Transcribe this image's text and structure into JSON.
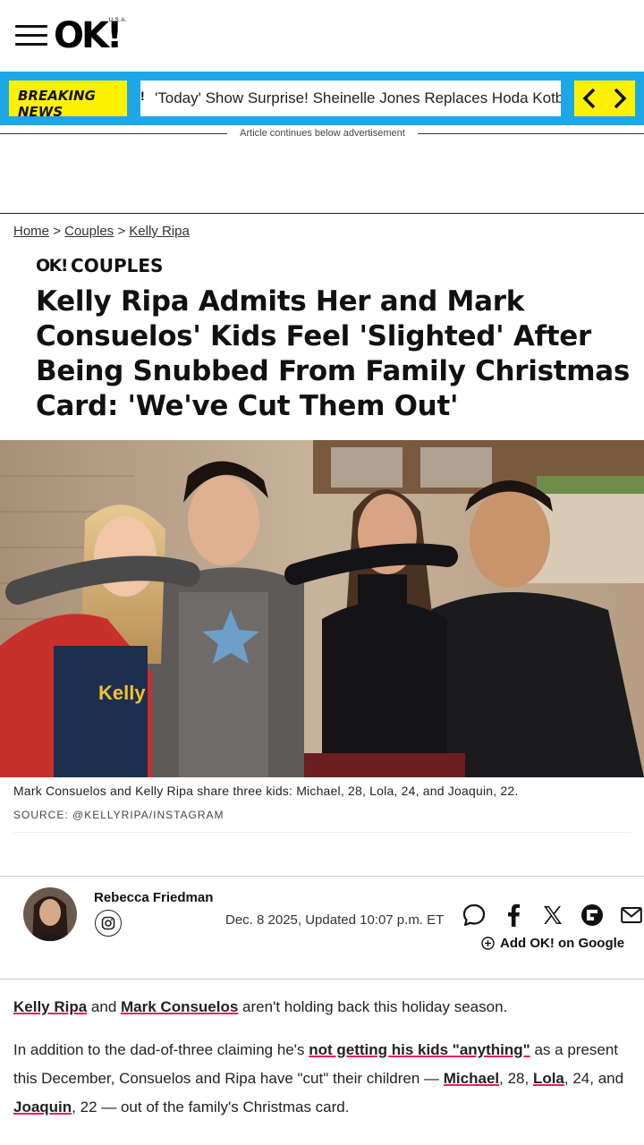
{
  "header": {
    "logo_text": "OK!",
    "logo_sub": "U.S.A."
  },
  "breaking": {
    "label_line1": "BREAKING",
    "label_line2": "NEWS",
    "ticker_text": "'Today' Show Surprise! Sheinelle Jones Replaces Hoda Kotb"
  },
  "ad": {
    "notice": "Article continues below advertisement"
  },
  "breadcrumb": {
    "items": [
      "Home",
      "Couples",
      "Kelly Ripa"
    ],
    "separator": ">"
  },
  "article": {
    "section_logo": "OK!",
    "section_name": "COUPLES",
    "headline": "Kelly Ripa Admits Her and Mark Consuelos' Kids Feel 'Slighted' After Being Snubbed From Family Christmas Card: 'We've Cut Them Out'",
    "photo_caption": "Mark Consuelos and Kelly Ripa share three kids: Michael, 28, Lola, 24, and Joaquin, 22.",
    "photo_source": "SOURCE: @KELLYRIPA/INSTAGRAM",
    "author": "Rebecca Friedman",
    "dateline": "Dec. 8 2025, Updated 10:07 p.m. ET",
    "google_cta": "Add OK! on Google"
  },
  "body": {
    "p1": {
      "link1": "Kelly Ripa",
      "t1": " and ",
      "link2": "Mark Consuelos",
      "t2": " aren't holding back this holiday season."
    },
    "p2": {
      "t1": "In addition to the dad-of-three claiming he's ",
      "link1": "not getting his kids \"anything\"",
      "t2": " as a present this December, Consuelos and Ripa have \"cut\" their children — ",
      "link2": "Michael",
      "t3": ", 28, ",
      "link3": "Lola",
      "t4": ", 24, and ",
      "link4": "Joaquin",
      "t5": ", 22 — out of the family's Christmas card."
    }
  },
  "colors": {
    "breaking_bar": "#1ea7e6",
    "breaking_label": "#fff200",
    "link_underline": "#e91e63"
  },
  "icons": [
    "menu-icon",
    "chevron-left-icon",
    "chevron-right-icon",
    "instagram-icon",
    "comment-icon",
    "facebook-icon",
    "x-icon",
    "flipboard-icon",
    "email-icon",
    "plus-circle-icon"
  ]
}
